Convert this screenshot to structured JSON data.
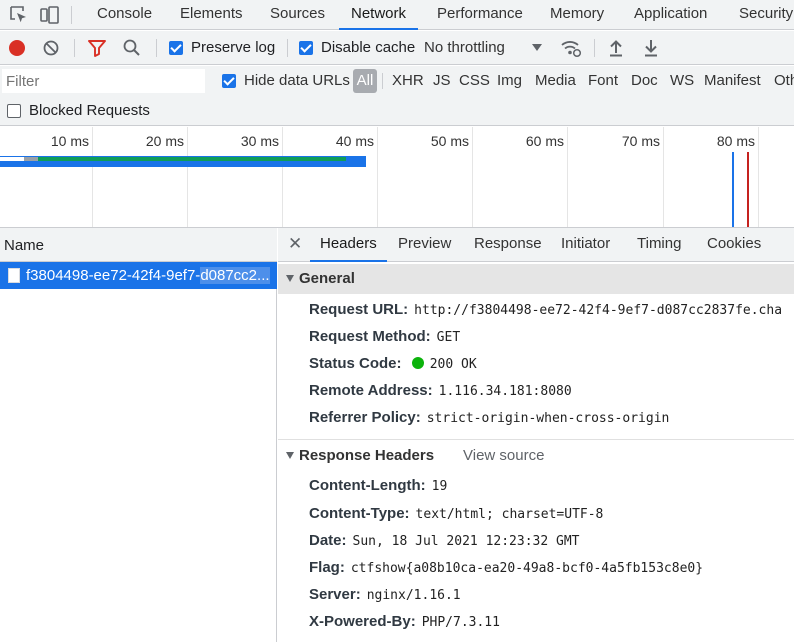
{
  "devtools_tabs": [
    "Console",
    "Elements",
    "Sources",
    "Network",
    "Performance",
    "Memory",
    "Application",
    "Security"
  ],
  "active_tab": "Network",
  "toolbar": {
    "preserve_log": "Preserve log",
    "disable_cache": "Disable cache",
    "throttling": "No throttling"
  },
  "filter": {
    "placeholder": "Filter",
    "hide_data_urls": "Hide data URLs",
    "types": [
      "All",
      "XHR",
      "JS",
      "CSS",
      "Img",
      "Media",
      "Font",
      "Doc",
      "WS",
      "Manifest",
      "Oth"
    ]
  },
  "blocked_requests": "Blocked Requests",
  "timeline": {
    "ticks": [
      "10 ms",
      "20 ms",
      "30 ms",
      "40 ms",
      "50 ms",
      "60 ms",
      "70 ms",
      "80 ms"
    ]
  },
  "requests": {
    "header": "Name",
    "rows": [
      {
        "name_part1": "f3804498-ee72-42f4-9ef7-",
        "name_part2": "d087cc2..."
      }
    ]
  },
  "detail": {
    "tabs": [
      "Headers",
      "Preview",
      "Response",
      "Initiator",
      "Timing",
      "Cookies"
    ],
    "active": "Headers",
    "general": {
      "title": "General",
      "rows": [
        {
          "key": "Request URL:",
          "value": "http://f3804498-ee72-42f4-9ef7-d087cc2837fe.cha"
        },
        {
          "key": "Request Method:",
          "value": "GET"
        },
        {
          "key": "Status Code:",
          "value": "200 OK"
        },
        {
          "key": "Remote Address:",
          "value": "1.116.34.181:8080"
        },
        {
          "key": "Referrer Policy:",
          "value": "strict-origin-when-cross-origin"
        }
      ]
    },
    "response_headers": {
      "title": "Response Headers",
      "view_source": "View source",
      "rows": [
        {
          "key": "Content-Length:",
          "value": "19"
        },
        {
          "key": "Content-Type:",
          "value": "text/html; charset=UTF-8"
        },
        {
          "key": "Date:",
          "value": "Sun, 18 Jul 2021 12:23:32 GMT"
        },
        {
          "key": "Flag:",
          "value": "ctfshow{a08b10ca-ea20-49a8-bcf0-4a5fb153c8e0}"
        },
        {
          "key": "Server:",
          "value": "nginx/1.16.1"
        },
        {
          "key": "X-Powered-By:",
          "value": "PHP/7.3.11"
        }
      ]
    }
  },
  "colors": {
    "accent": "#1a73e8",
    "record": "#d93025",
    "status_ok": "#0cb30c"
  }
}
